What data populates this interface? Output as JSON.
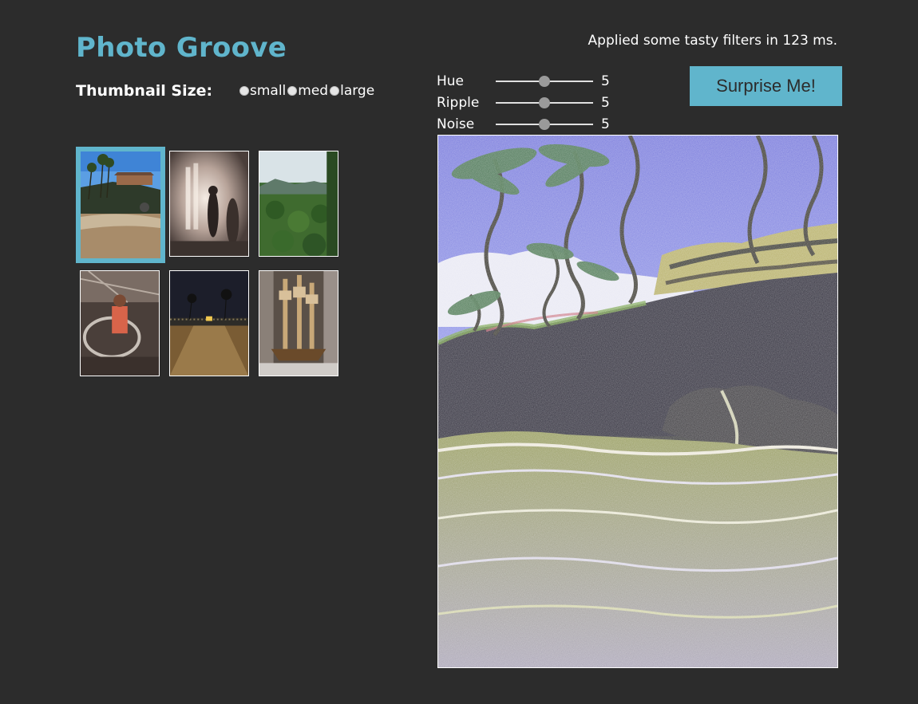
{
  "header": {
    "title": "Photo Groove",
    "status": "Applied some tasty filters in 123 ms."
  },
  "thumbnail_size": {
    "label": "Thumbnail Size:",
    "options": [
      "small",
      "med",
      "large"
    ]
  },
  "filters": [
    {
      "name": "Hue",
      "value": "5",
      "level": 0.5
    },
    {
      "name": "Ripple",
      "value": "5",
      "level": 0.5
    },
    {
      "name": "Noise",
      "value": "5",
      "level": 0.5
    }
  ],
  "surprise_button": {
    "label": "Surprise Me!"
  },
  "thumbnails": [
    {
      "subject": "beach-rock-palms",
      "selected": true
    },
    {
      "subject": "concert-stage",
      "selected": false
    },
    {
      "subject": "jungle-valley",
      "selected": false
    },
    {
      "subject": "man-at-wheel",
      "selected": false
    },
    {
      "subject": "night-pier",
      "selected": false
    },
    {
      "subject": "ship-model",
      "selected": false
    }
  ],
  "colors": {
    "accent": "#60b5cc",
    "background": "#2c2c2c",
    "text": "#ffffff"
  }
}
